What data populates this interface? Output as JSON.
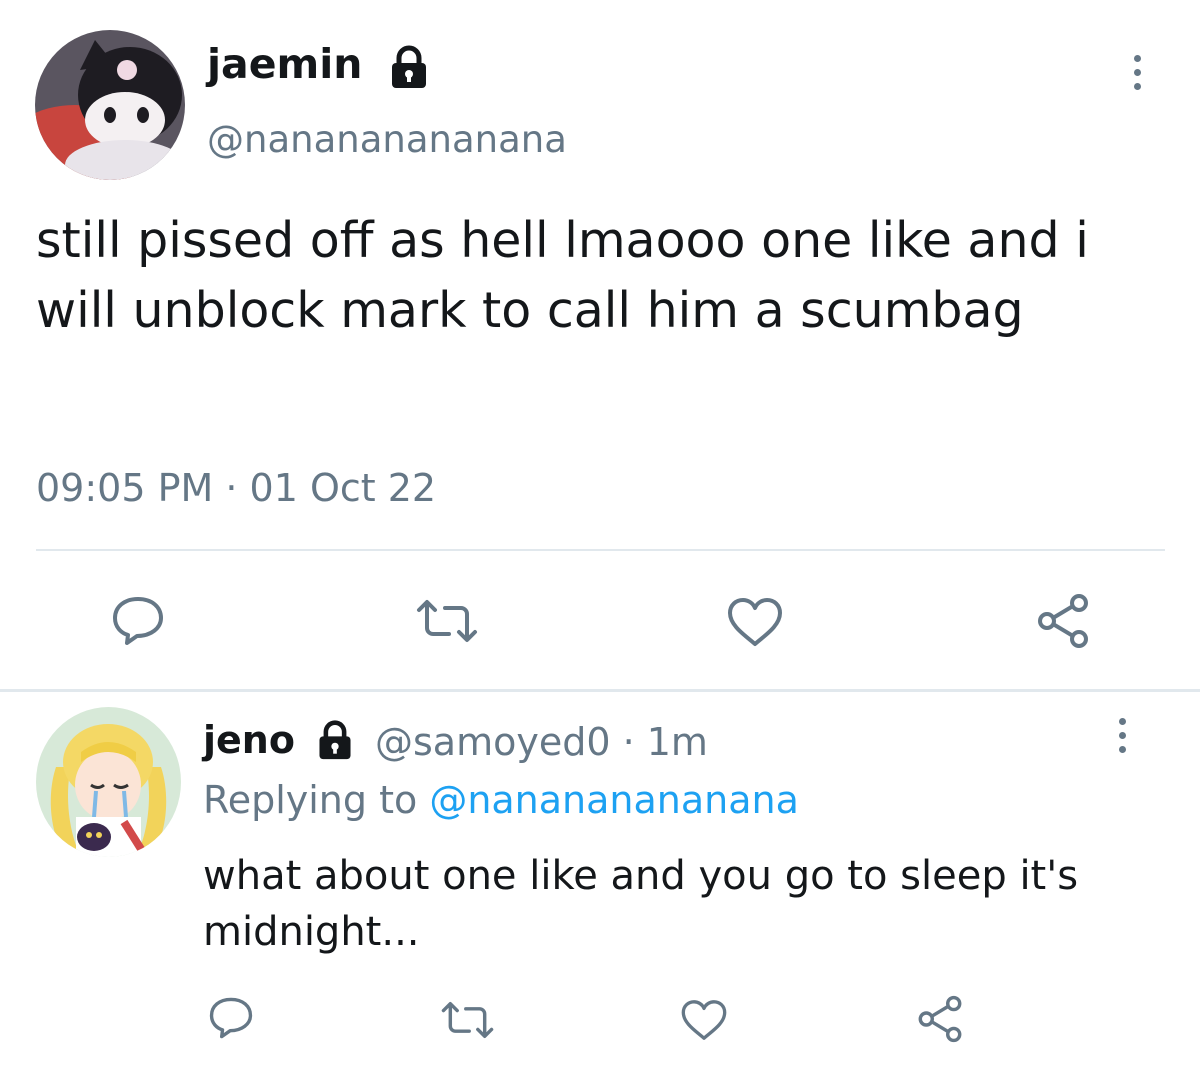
{
  "main_tweet": {
    "display_name": "jaemin",
    "handle": "@nanananananana",
    "text": "still pissed off as hell lmaooo one like and i will unblock mark to call him a scumbag",
    "timestamp": "09:05 PM · 01 Oct 22",
    "icons": {
      "lock": "lock-icon",
      "more": "more-vertical-icon",
      "reply": "reply-icon",
      "retweet": "retweet-icon",
      "like": "like-icon",
      "share": "share-icon"
    }
  },
  "reply_tweet": {
    "display_name": "jeno",
    "handle_time": "@samoyed0 · 1m",
    "replying_prefix": "Replying to ",
    "replying_to": "@nanananananana",
    "text": "what about one like and you go to sleep it's midnight..."
  },
  "colors": {
    "text": "#14171a",
    "secondary": "#657786",
    "link": "#1da1f2",
    "divider": "#e1e8ed"
  }
}
